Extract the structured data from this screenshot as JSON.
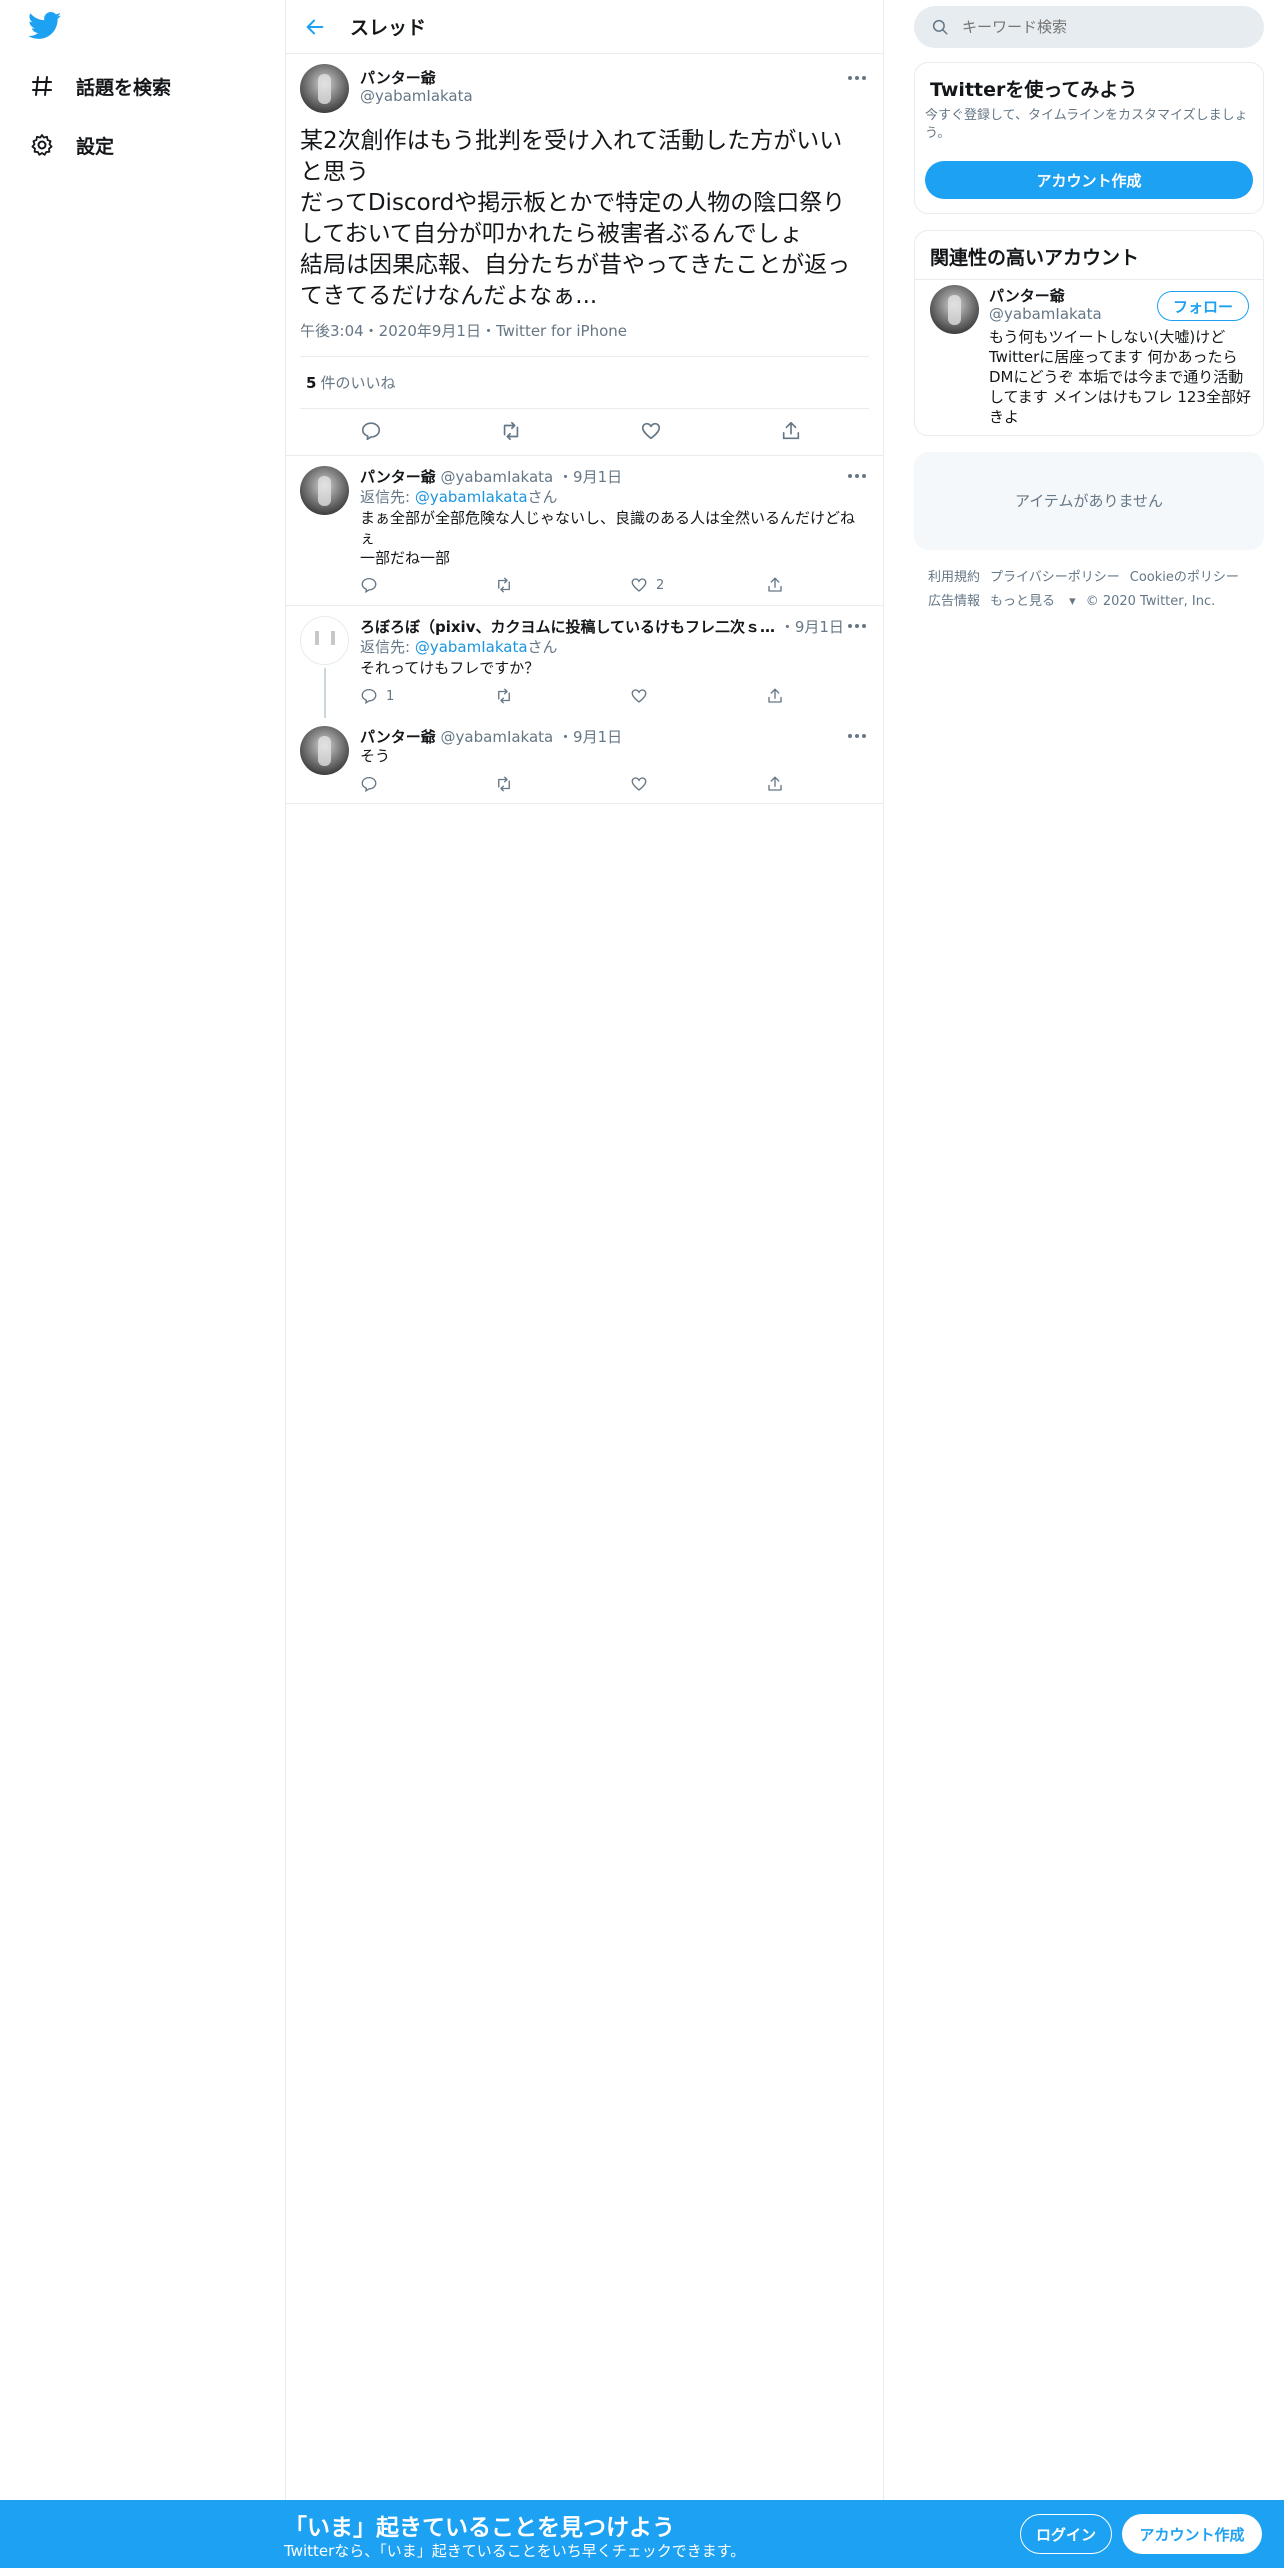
{
  "nav": {
    "items": [
      {
        "label": "話題を検索",
        "icon": "hashtag-icon"
      },
      {
        "label": "設定",
        "icon": "gear-icon"
      }
    ]
  },
  "header": {
    "title": "スレッド"
  },
  "focus_tweet": {
    "name": "パンター爺",
    "handle": "@yabamIakata",
    "text": "某2次創作はもう批判を受け入れて活動した方がいいと思う\nだってDiscordや掲示板とかで特定の人物の陰口祭りしておいて自分が叩かれたら被害者ぶるんでしょ\n結局は因果応報、自分たちが昔やってきたことが返ってきてるだけなんだよなぁ...",
    "meta": "午後3:04・2020年9月1日・Twitter for iPhone",
    "likes_count": "5",
    "likes_label": "件のいいね"
  },
  "replies": [
    {
      "name": "パンター爺",
      "handle": "@yabamIakata",
      "date": "・9月1日",
      "reply_prefix": "返信先: ",
      "reply_to": "@yabamIakata",
      "reply_suffix": "さん",
      "text": "まぁ全部が全部危険な人じゃないし、良識のある人は全然いるんだけどねぇ\n一部だね一部",
      "reply_count": "",
      "like_count": "2"
    },
    {
      "name": "ろぼろぼ（pixiv、カクヨムに投稿しているけもフレ二次ｓ…",
      "handle": "",
      "date": "・9月1日",
      "reply_prefix": "返信先: ",
      "reply_to": "@yabamIakata",
      "reply_suffix": "さん",
      "text": "それってけもフレですか？",
      "reply_count": "1",
      "like_count": ""
    },
    {
      "name": "パンター爺",
      "handle": "@yabamIakata",
      "date": "・9月1日",
      "text": "そう",
      "reply_count": "",
      "like_count": ""
    }
  ],
  "right": {
    "search_placeholder": "キーワード検索",
    "signup_card": {
      "title": "Twitterを使ってみよう",
      "desc": "今すぐ登録して、タイムラインをカスタマイズしましょう。",
      "button": "アカウント作成"
    },
    "related": {
      "title": "関連性の高いアカウント",
      "name": "パンター爺",
      "handle": "@yabamIakata",
      "follow": "フォロー",
      "bio": "もう何もツイートしない(大嘘)けどTwitterに居座ってます 何かあったらDMにどうぞ 本垢では今まで通り活動してます メインはけもフレ 123全部好きよ"
    },
    "empty_card": "アイテムがありません",
    "footer": {
      "terms": "利用規約",
      "privacy": "プライバシーポリシー",
      "cookie": "Cookieのポリシー",
      "ads": "広告情報",
      "more": "もっと見る",
      "copyright": "© 2020 Twitter, Inc."
    }
  },
  "bottom": {
    "title": "「いま」起きていることを見つけよう",
    "subtitle": "Twitterなら、「いま」起きていることをいち早くチェックできます。",
    "login": "ログイン",
    "signup": "アカウント作成"
  },
  "colors": {
    "accent": "#1da1f2",
    "text": "#14171a",
    "muted": "#657786",
    "border": "#e6ecf0"
  }
}
